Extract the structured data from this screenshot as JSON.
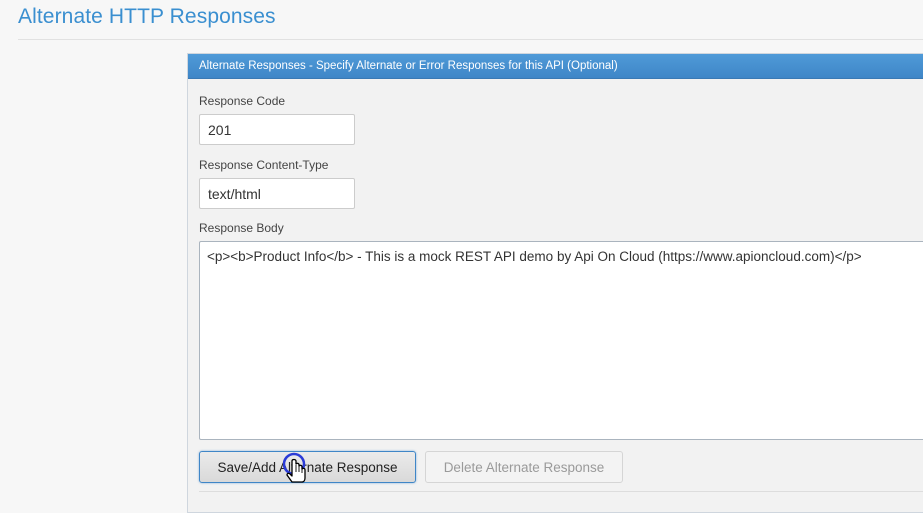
{
  "page": {
    "title": "Alternate HTTP Responses"
  },
  "panel": {
    "header": "Alternate Responses - Specify Alternate or Error Responses for this API (Optional)",
    "response_code": {
      "label": "Response Code",
      "value": "201"
    },
    "content_type": {
      "label": "Response Content-Type",
      "value": "text/html"
    },
    "response_body": {
      "label": "Response Body",
      "value": "<p><b>Product Info</b> - This is a mock REST API demo by Api On Cloud (https://www.apioncloud.com)</p>"
    },
    "buttons": {
      "save": "Save/Add Alternate Response",
      "delete": "Delete Alternate Response"
    }
  },
  "colors": {
    "title": "#3a8fd0",
    "panel_header_bg": "#4592d2",
    "focus_ring": "#3f86c7",
    "page_bg": "#f7f7f7"
  },
  "icons": {
    "cursor": "hand-pointer-icon"
  }
}
